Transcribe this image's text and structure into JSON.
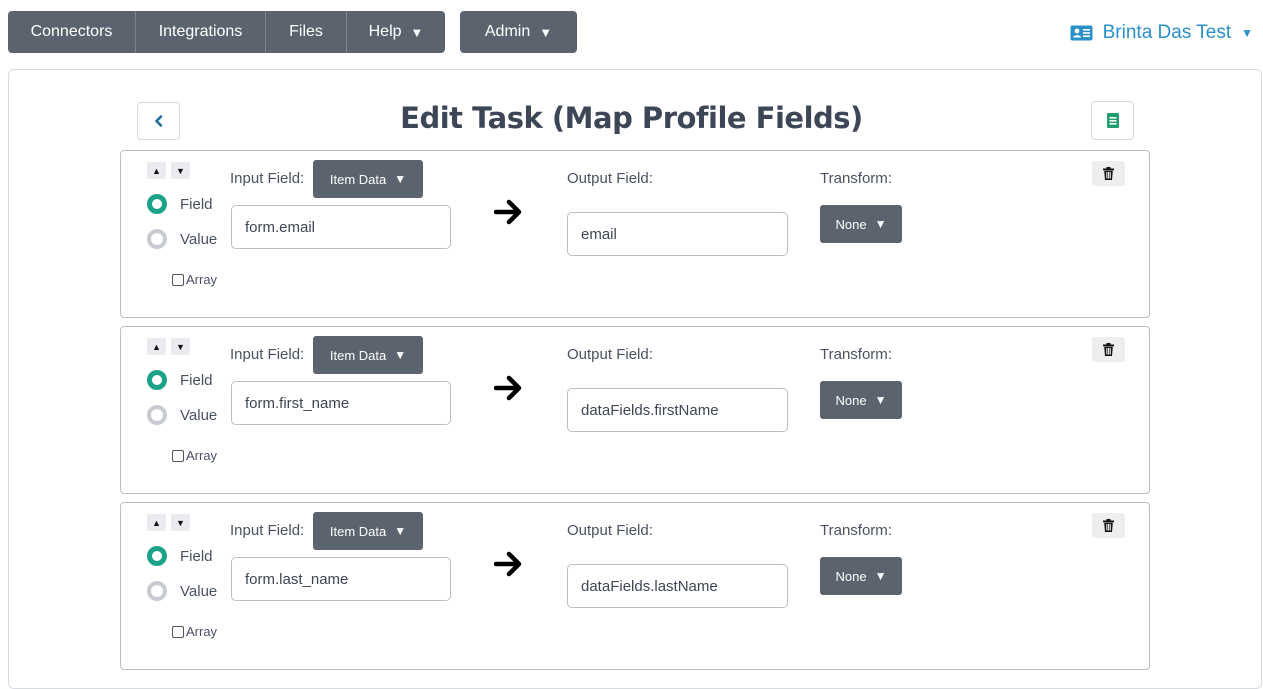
{
  "nav": {
    "items": [
      "Connectors",
      "Integrations",
      "Files",
      "Help"
    ],
    "admin_label": "Admin"
  },
  "user": {
    "name": "Brinta Das Test"
  },
  "page": {
    "title": "Edit Task (Map Profile Fields)"
  },
  "labels": {
    "input_field": "Input Field:",
    "output_field": "Output Field:",
    "transform": "Transform:",
    "field": "Field",
    "value": "Value",
    "array": "Array",
    "item_data": "Item Data",
    "none": "None"
  },
  "mappings": [
    {
      "input_value": "form.email",
      "output_value": "email",
      "source_type": "Item Data",
      "transform": "None",
      "mode": "Field",
      "array": false
    },
    {
      "input_value": "form.first_name",
      "output_value": "dataFields.firstName",
      "source_type": "Item Data",
      "transform": "None",
      "mode": "Field",
      "array": false
    },
    {
      "input_value": "form.last_name",
      "output_value": "dataFields.lastName",
      "source_type": "Item Data",
      "transform": "None",
      "mode": "Field",
      "array": false
    }
  ],
  "colors": {
    "nav_bg": "#5b646e",
    "accent_teal": "#1ba38a",
    "link_blue": "#2a90c8",
    "doc_green": "#1e9e6d"
  },
  "icons": {
    "back": "chevron-left-icon",
    "document": "document-icon",
    "user": "id-card-icon",
    "delete": "trash-icon",
    "map": "arrow-right-icon"
  }
}
